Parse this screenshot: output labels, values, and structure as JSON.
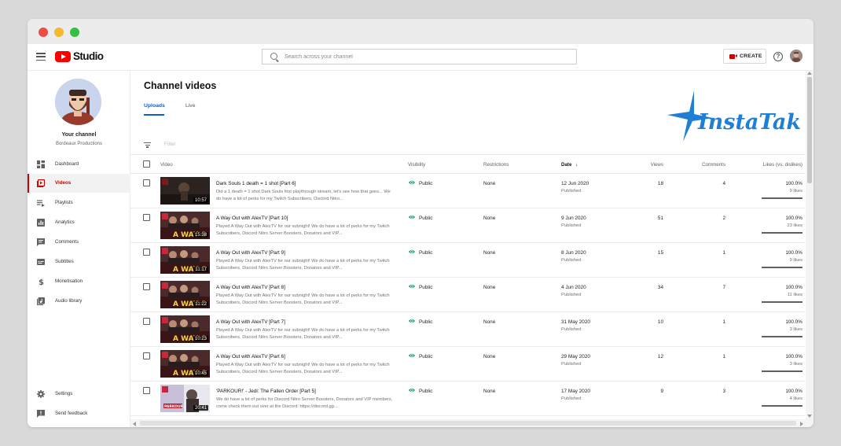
{
  "topbar": {
    "logo_text": "Studio",
    "search_placeholder": "Search across your channel",
    "create_label": "CREATE",
    "help_glyph": "?"
  },
  "sidebar": {
    "your_channel": "Your channel",
    "channel_name": "Bordeaux Productions",
    "items": [
      {
        "label": "Dashboard",
        "icon": "dashboard-icon"
      },
      {
        "label": "Videos",
        "icon": "videos-icon",
        "active": true
      },
      {
        "label": "Playlists",
        "icon": "playlists-icon"
      },
      {
        "label": "Analytics",
        "icon": "analytics-icon"
      },
      {
        "label": "Comments",
        "icon": "comments-icon"
      },
      {
        "label": "Subtitles",
        "icon": "subtitles-icon"
      },
      {
        "label": "Monetisation",
        "icon": "monetisation-icon"
      },
      {
        "label": "Audio library",
        "icon": "audio-library-icon"
      }
    ],
    "bottom_items": [
      {
        "label": "Settings",
        "icon": "gear-icon"
      },
      {
        "label": "Send feedback",
        "icon": "feedback-icon"
      }
    ]
  },
  "main": {
    "title": "Channel videos",
    "tabs": [
      "Uploads",
      "Live"
    ],
    "filter_placeholder": "Filter",
    "watermark": "InstaTakipci",
    "columns": {
      "video": "Video",
      "visibility": "Visibility",
      "restrictions": "Restrictions",
      "date": "Date",
      "date_sort_glyph": "↓",
      "views": "Views",
      "comments": "Comments",
      "likes": "Likes (vs. dislikes)"
    },
    "rows": [
      {
        "title": "Dark Souls 1 death = 1 shot [Part 6]",
        "desc": "Did a 1 death = 1 shot Dark Souls first playthrough stream, let's see how that goes... We do have a lot of perks for my Twitch Subscribers, Discord Nitro...",
        "duration": "10:57",
        "visibility": "Public",
        "restrictions": "None",
        "date": "12 Jun 2020",
        "status": "Published",
        "views": "18",
        "comments": "4",
        "likes_pct": "100.0%",
        "likes_count": "9 likes",
        "likes_ratio": 1.0,
        "thumb": "dark"
      },
      {
        "title": "A Way Out with AlexTV [Part 10]",
        "desc": "Played A Way Out with AlexTV for our subnight! We do have a lot of perks for my Twitch Subscribers, Discord Nitro Server Boosters, Donators and VIP...",
        "duration": "15:38",
        "visibility": "Public",
        "restrictions": "None",
        "date": "9 Jun 2020",
        "status": "Published",
        "views": "51",
        "comments": "2",
        "likes_pct": "100.0%",
        "likes_count": "23 likes",
        "likes_ratio": 1.0,
        "thumb": "awayout"
      },
      {
        "title": "A Way Out with AlexTV [Part 9]",
        "desc": "Played A Way Out with AlexTV for our subnight! We do have a lot of perks for my Twitch Subscribers, Discord Nitro Server Boosters, Donators and VIP...",
        "duration": "11:17",
        "visibility": "Public",
        "restrictions": "None",
        "date": "8 Jun 2020",
        "status": "Published",
        "views": "15",
        "comments": "1",
        "likes_pct": "100.0%",
        "likes_count": "9 likes",
        "likes_ratio": 1.0,
        "thumb": "awayout"
      },
      {
        "title": "A Way Out with AlexTV [Part 8]",
        "desc": "Played A Way Out with AlexTV for our subnight! We do have a lot of perks for my Twitch Subscribers, Discord Nitro Server Boosters, Donators and VIP...",
        "duration": "11:22",
        "visibility": "Public",
        "restrictions": "None",
        "date": "4 Jun 2020",
        "status": "Published",
        "views": "34",
        "comments": "7",
        "likes_pct": "100.0%",
        "likes_count": "11 likes",
        "likes_ratio": 1.0,
        "thumb": "awayout"
      },
      {
        "title": "A Way Out with AlexTV [Part 7]",
        "desc": "Played A Way Out with AlexTV for our subnight! We do have a lot of perks for my Twitch Subscribers, Discord Nitro Server Boosters, Donators and VIP...",
        "duration": "10:23",
        "visibility": "Public",
        "restrictions": "None",
        "date": "31 May 2020",
        "status": "Published",
        "views": "10",
        "comments": "1",
        "likes_pct": "100.0%",
        "likes_count": "3 likes",
        "likes_ratio": 1.0,
        "thumb": "awayout"
      },
      {
        "title": "A Way Out with AlexTV [Part 6]",
        "desc": "Played A Way Out with AlexTV for our subnight! We do have a lot of perks for my Twitch Subscribers, Discord Nitro Server Boosters, Donators and VIP...",
        "duration": "10:45",
        "visibility": "Public",
        "restrictions": "None",
        "date": "29 May 2020",
        "status": "Published",
        "views": "12",
        "comments": "1",
        "likes_pct": "100.0%",
        "likes_count": "3 likes",
        "likes_ratio": 1.0,
        "thumb": "awayout"
      },
      {
        "title": "'PARKOUR!' - Jedi: The Fallen Order [Part 5]",
        "desc": "We do have a lot of perks for Discord Nitro Server Boosters, Donators and VIP members, come check them out over at the Discord: https://discord.gg...",
        "duration": "20:41",
        "visibility": "Public",
        "restrictions": "None",
        "date": "17 May 2020",
        "status": "Published",
        "views": "9",
        "comments": "3",
        "likes_pct": "100.0%",
        "likes_count": "4 likes",
        "likes_ratio": 1.0,
        "thumb": "jedi"
      }
    ]
  },
  "colors": {
    "accent_red": "#cc0000",
    "link_blue": "#065fd4",
    "public_green": "#0f9d58",
    "watermark_blue": "#1f7fd6"
  }
}
